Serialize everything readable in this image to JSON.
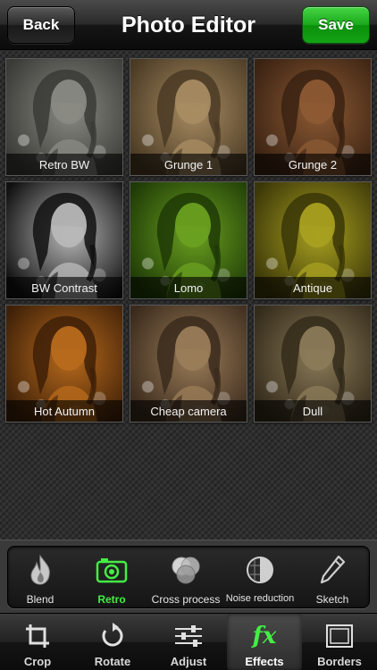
{
  "navbar": {
    "back_label": "Back",
    "title": "Photo Editor",
    "save_label": "Save"
  },
  "effects": [
    {
      "label": "Retro BW",
      "tint": "#8a8a84",
      "tint_dark": "#3a3a36"
    },
    {
      "label": "Grunge 1",
      "tint": "#a88c62",
      "tint_dark": "#4a3a24"
    },
    {
      "label": "Grunge 2",
      "tint": "#8c5a34",
      "tint_dark": "#3a2212"
    },
    {
      "label": "BW Contrast",
      "tint": "#b8b8b8",
      "tint_dark": "#101010"
    },
    {
      "label": "Lomo",
      "tint": "#6aa020",
      "tint_dark": "#1e3a06"
    },
    {
      "label": "Antique",
      "tint": "#a8a020",
      "tint_dark": "#3a3608"
    },
    {
      "label": "Hot Autumn",
      "tint": "#b86a1c",
      "tint_dark": "#3e2008"
    },
    {
      "label": "Cheap camera",
      "tint": "#9a7c58",
      "tint_dark": "#3a2a1c"
    },
    {
      "label": "Dull",
      "tint": "#8a7a58",
      "tint_dark": "#332a1a"
    }
  ],
  "categories": [
    {
      "label": "Blend",
      "icon": "flame-icon",
      "active": false
    },
    {
      "label": "Retro",
      "icon": "camera-icon",
      "active": true
    },
    {
      "label": "Cross process",
      "icon": "overlapping-circles-icon",
      "active": false
    },
    {
      "label": "Noise reduction",
      "icon": "half-circle-icon",
      "active": false
    },
    {
      "label": "Sketch",
      "icon": "pencil-icon",
      "active": false
    }
  ],
  "tabs": [
    {
      "label": "Crop",
      "icon": "crop-icon",
      "active": false
    },
    {
      "label": "Rotate",
      "icon": "rotate-icon",
      "active": false
    },
    {
      "label": "Adjust",
      "icon": "sliders-icon",
      "active": false
    },
    {
      "label": "Effects",
      "icon": "fx-icon",
      "active": true
    },
    {
      "label": "Borders",
      "icon": "frame-icon",
      "active": false
    }
  ],
  "colors": {
    "accent_green": "#44ee44",
    "save_green": "#19a819"
  }
}
